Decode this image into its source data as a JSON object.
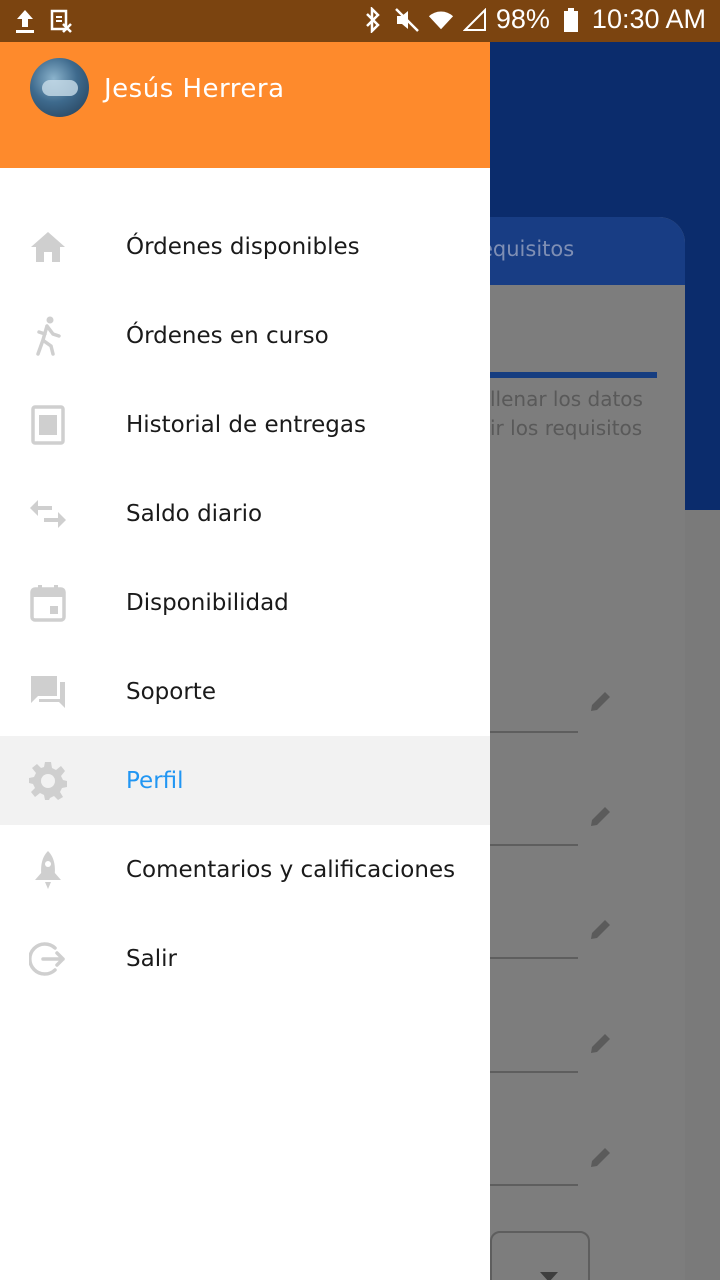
{
  "status_bar": {
    "battery": "98%",
    "time": "10:30 AM"
  },
  "drawer": {
    "user_name": "Jesús Herrera",
    "items": [
      {
        "label": "Órdenes disponibles",
        "icon": "home-icon"
      },
      {
        "label": "Órdenes en curso",
        "icon": "walking-icon"
      },
      {
        "label": "Historial de entregas",
        "icon": "document-icon"
      },
      {
        "label": "Saldo diario",
        "icon": "swap-arrows-icon"
      },
      {
        "label": "Disponibilidad",
        "icon": "calendar-icon"
      },
      {
        "label": "Soporte",
        "icon": "chat-icon"
      },
      {
        "label": "Perfil",
        "icon": "gear-icon",
        "active": true
      },
      {
        "label": "Comentarios y calificaciones",
        "icon": "rocket-icon"
      },
      {
        "label": "Salir",
        "icon": "logout-icon"
      }
    ],
    "accent_color": "#fe8a2c",
    "active_color": "#2196f3"
  },
  "background_app": {
    "card_title": "equisitos",
    "text_line_1": "llenar los datos",
    "text_line_2": "ir los requisitos"
  }
}
